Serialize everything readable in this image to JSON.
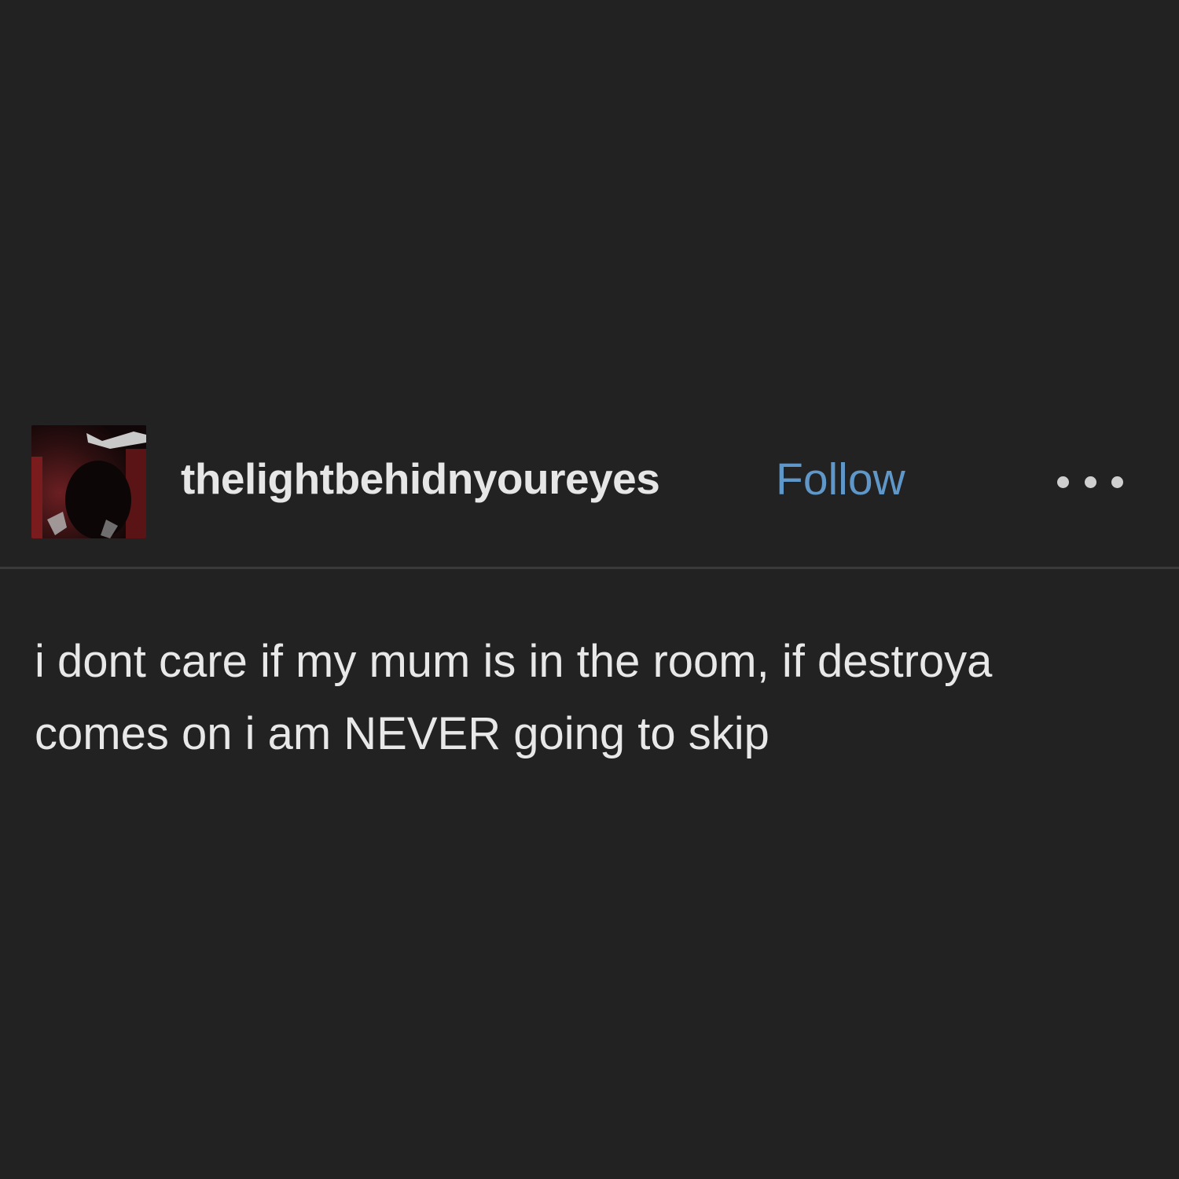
{
  "post": {
    "username": "thelightbehidnyoureyes",
    "follow_label": "Follow",
    "more_icon": "ellipsis-icon",
    "avatar_icon": "avatar-image",
    "text_lines": [
      "i dont care if my mum is in the room, if destroya",
      "comes on i am NEVER going to skip"
    ]
  },
  "colors": {
    "background": "#222223",
    "follow": "#5f97c9",
    "text": "#e8e8e8"
  }
}
